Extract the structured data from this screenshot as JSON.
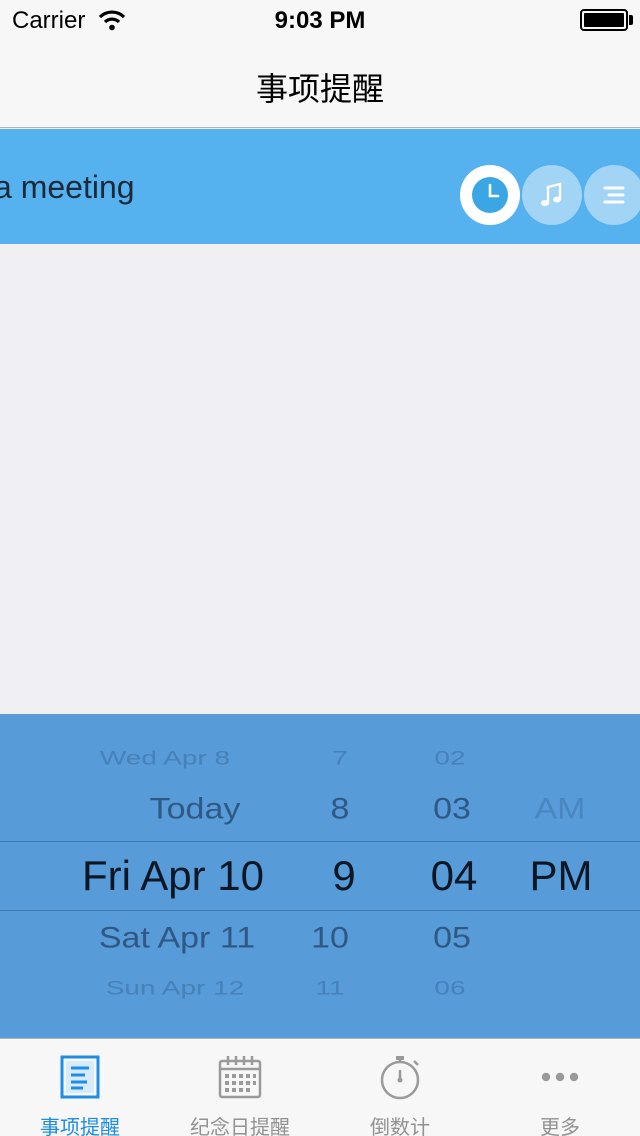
{
  "status_bar": {
    "carrier": "Carrier",
    "time": "9:03 PM"
  },
  "nav": {
    "title": "事项提醒"
  },
  "reminder": {
    "text": "a meeting",
    "buttons": [
      {
        "icon": "clock-icon",
        "active": true
      },
      {
        "icon": "music-note-icon",
        "active": false
      },
      {
        "icon": "list-icon",
        "active": false
      }
    ]
  },
  "picker": {
    "day": [
      "Wed Apr 8",
      "Today",
      "Fri Apr 10",
      "Sat Apr 11",
      "Sun Apr 12"
    ],
    "hour": [
      "7",
      "8",
      "9",
      "10",
      "11"
    ],
    "minute": [
      "02",
      "03",
      "04",
      "05",
      "06"
    ],
    "ampm": [
      "AM",
      "PM"
    ]
  },
  "tabs": [
    {
      "label": "事项提醒",
      "icon": "document-list-icon",
      "active": true
    },
    {
      "label": "纪念日提醒",
      "icon": "calendar-icon",
      "active": false
    },
    {
      "label": "倒数计",
      "icon": "stopwatch-icon",
      "active": false
    },
    {
      "label": "更多",
      "icon": "more-dots-icon",
      "active": false
    }
  ],
  "colors": {
    "accent": "#1f8ce5",
    "reminder_bg": "#56b1ef",
    "picker_bg": "#579bd9",
    "tab_inactive": "#929292"
  }
}
